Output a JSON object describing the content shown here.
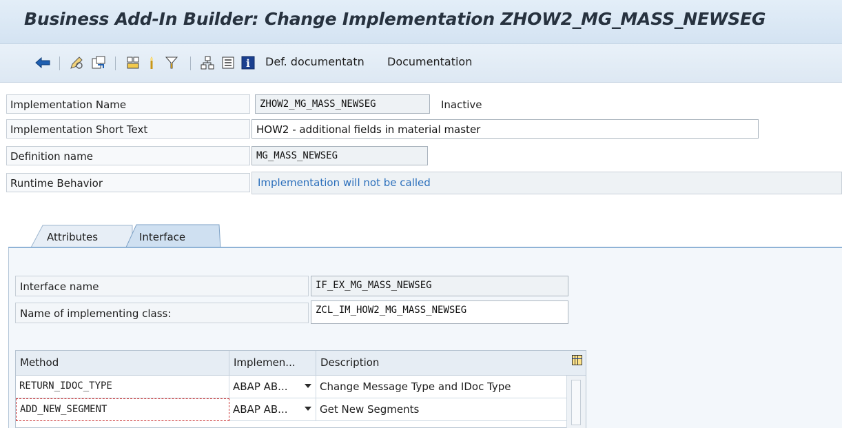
{
  "window": {
    "title": "Business Add-In Builder: Change Implementation ZHOW2_MG_MASS_NEWSEG"
  },
  "toolbar": {
    "icons": [
      "back-arrow-icon",
      "display-change-icon",
      "other-object-icon",
      "activate-icon",
      "deactivate-icon",
      "filter-icon",
      "hierarchy-icon",
      "list-icon",
      "info-icon"
    ],
    "def_documentation_label": "Def. documentatn",
    "documentation_label": "Documentation"
  },
  "form": {
    "impl_name_label": "Implementation Name",
    "impl_name_value": "ZHOW2_MG_MASS_NEWSEG",
    "impl_status": "Inactive",
    "short_text_label": "Implementation Short Text",
    "short_text_value": "HOW2 - additional fields in material master",
    "definition_label": "Definition name",
    "definition_value": "MG_MASS_NEWSEG",
    "runtime_label": "Runtime Behavior",
    "runtime_value": "Implementation will not be called"
  },
  "tabs": [
    {
      "label": "Attributes",
      "active": false
    },
    {
      "label": "Interface",
      "active": true
    }
  ],
  "interface": {
    "name_label": "Interface name",
    "name_value": "IF_EX_MG_MASS_NEWSEG",
    "class_label": "Name of implementing class:",
    "class_value": "ZCL_IM_HOW2_MG_MASS_NEWSEG"
  },
  "methods_table": {
    "columns": [
      "Method",
      "Implemen...",
      "Description"
    ],
    "rows": [
      {
        "method": "RETURN_IDOC_TYPE",
        "impl": "ABAP AB...",
        "description": "Change Message Type and IDoc Type"
      },
      {
        "method": "ADD_NEW_SEGMENT",
        "impl": "ABAP AB...",
        "description": "Get New Segments"
      }
    ]
  },
  "colors": {
    "title_bg": "#d9e6f3",
    "accent": "#2a6ebb",
    "tab_active": "#cfe0f1"
  }
}
